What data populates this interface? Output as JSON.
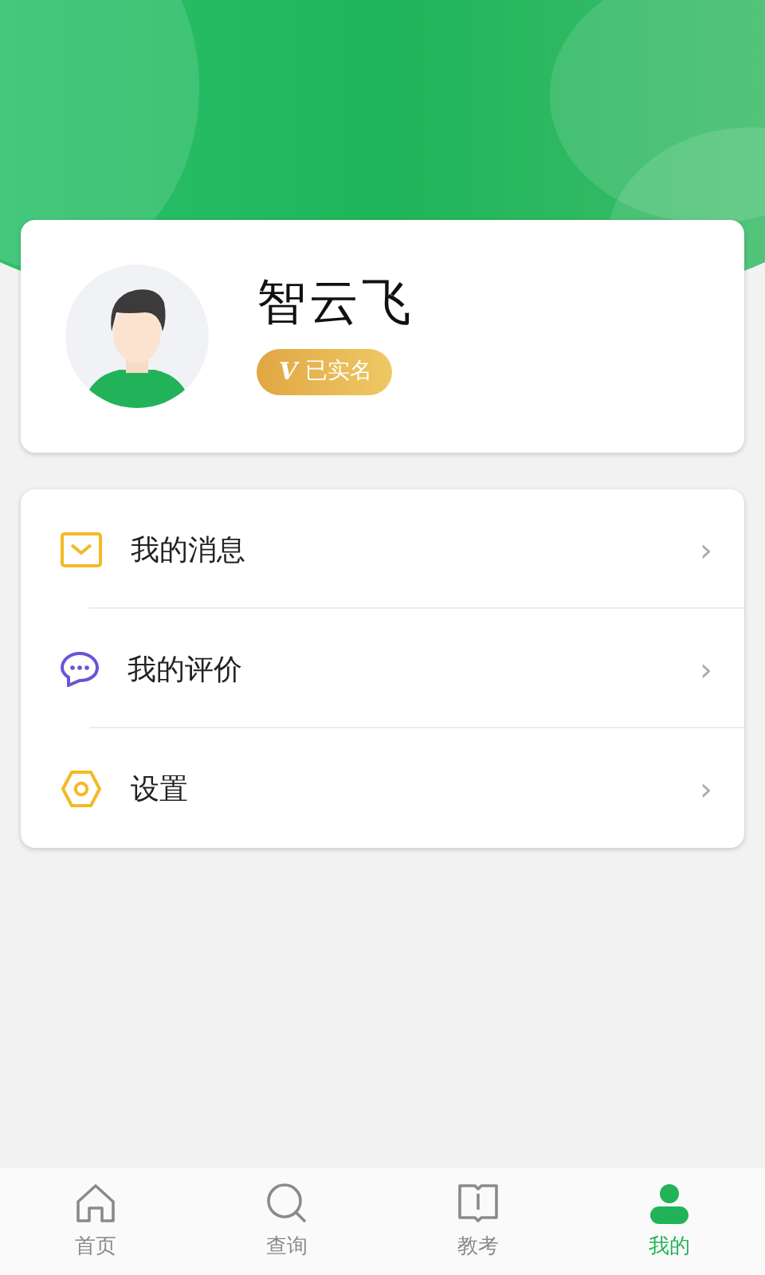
{
  "profile": {
    "name": "智云飞",
    "verified_mark": "V",
    "verified_label": "已实名"
  },
  "menu": [
    {
      "label": "我的消息",
      "chevron": "›"
    },
    {
      "label": "我的评价",
      "chevron": "›"
    },
    {
      "label": "设置",
      "chevron": "›"
    }
  ],
  "tabs": [
    {
      "label": "首页",
      "selected": false
    },
    {
      "label": "查询",
      "selected": false
    },
    {
      "label": "教考",
      "selected": false
    },
    {
      "label": "我的",
      "selected": true
    }
  ]
}
